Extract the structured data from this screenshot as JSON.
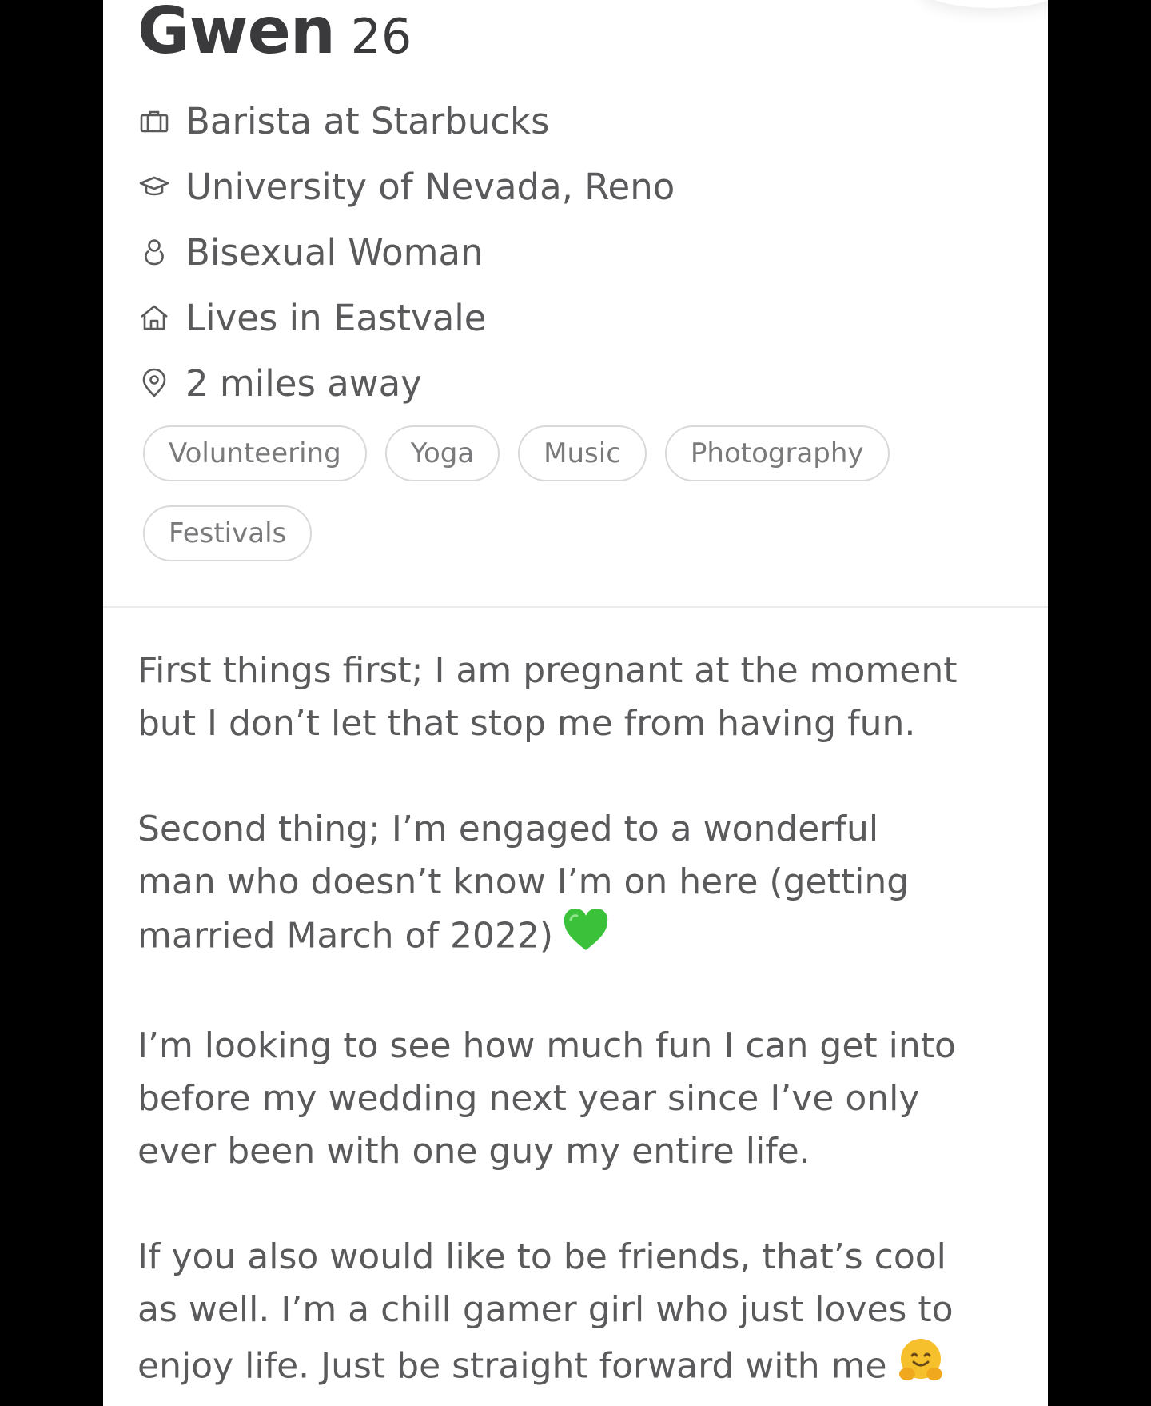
{
  "profile": {
    "name": "Gwen",
    "age": "26",
    "job": "Barista at Starbucks",
    "school": "University of Nevada, Reno",
    "orientation": "Bisexual Woman",
    "lives_in": "Lives in Eastvale",
    "distance": "2 miles away"
  },
  "icons": {
    "job": "briefcase-icon",
    "school": "graduation-cap-icon",
    "orientation": "person-icon",
    "lives_in": "home-icon",
    "distance": "location-pin-icon"
  },
  "interests": [
    "Volunteering",
    "Yoga",
    "Music",
    "Photography",
    "Festivals"
  ],
  "bio": {
    "p1": "First things first; I am pregnant at the moment\nbut I don’t let that stop me from having fun.",
    "p2": "Second thing; I’m engaged to a wonderful\nman who doesn’t know I’m on here (getting\nmarried March of 2022)",
    "p3": "I’m looking to see how much fun I can get into\nbefore my wedding next year since I’ve only\never been with one guy my entire life.",
    "p4": "If you also would like to be friends, that’s cool\nas well. I’m a chill gamer girl who just loves to\nenjoy life. Just be straight forward with me"
  },
  "colors": {
    "text": "#5a5a5c",
    "heading": "#3a3a3c",
    "chip_border": "#d9d9dc",
    "green_heart": "#3cc13b",
    "hug_emoji": "#f6c02c"
  }
}
